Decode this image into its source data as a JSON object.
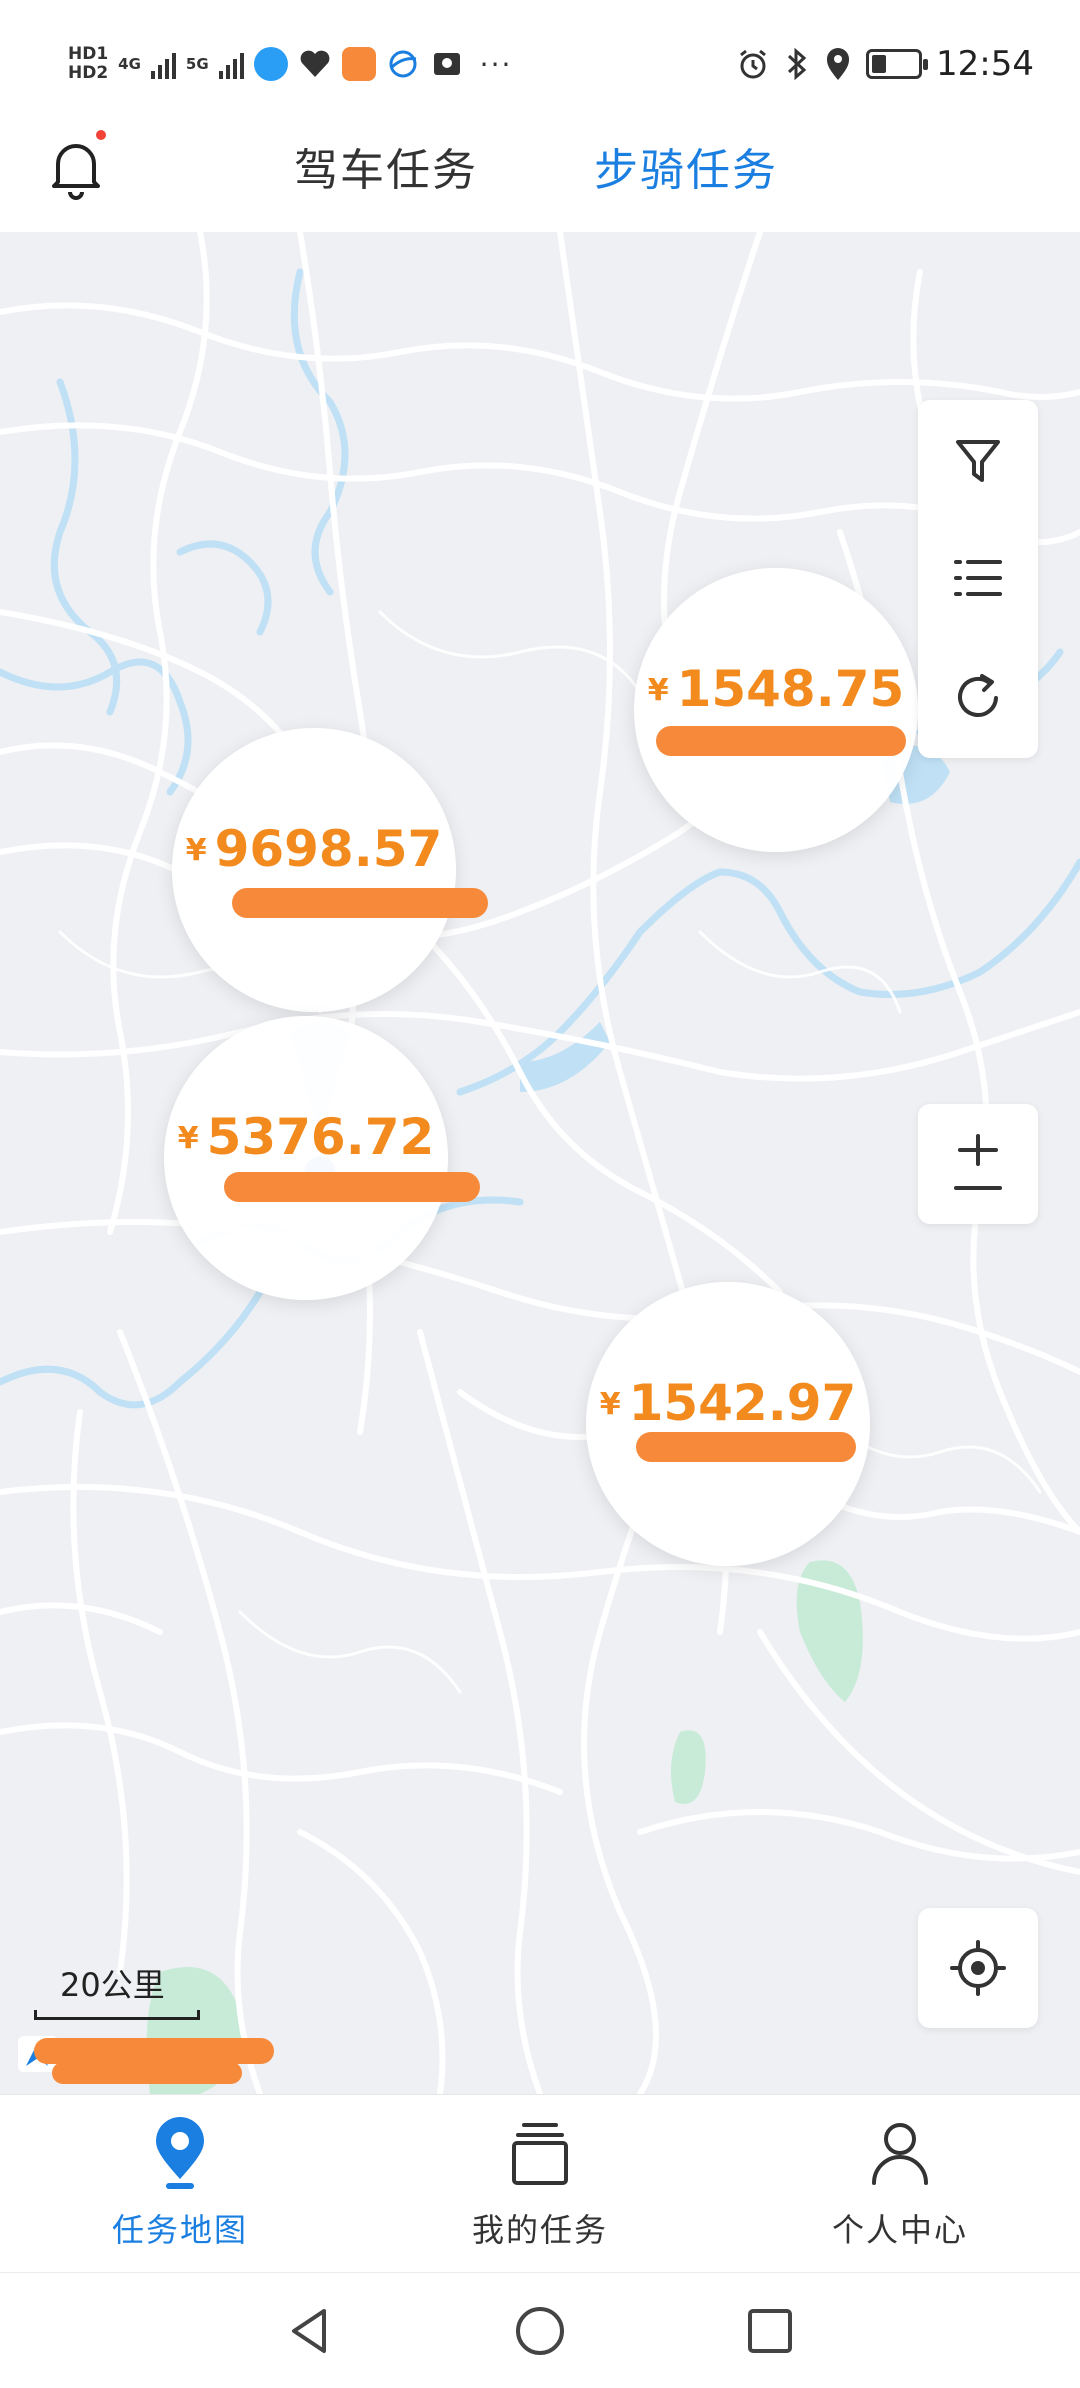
{
  "status_bar": {
    "hd1": "HD1",
    "hd2": "HD2",
    "net1": "4G",
    "net2": "5G",
    "more": "···",
    "time": "12:54",
    "icons": [
      "alarm-icon",
      "bluetooth-icon",
      "location-icon",
      "battery-icon"
    ]
  },
  "header": {
    "tabs": [
      {
        "label": "驾车任务",
        "active": false
      },
      {
        "label": "步骑任务",
        "active": true
      }
    ],
    "accent_color": "#1a7fe0"
  },
  "map": {
    "tasks": [
      {
        "currency": "¥",
        "amount": "1548.75"
      },
      {
        "currency": "¥",
        "amount": "9698.57"
      },
      {
        "currency": "¥",
        "amount": "5376.72"
      },
      {
        "currency": "¥",
        "amount": "1542.97"
      }
    ],
    "price_color": "#f28a1e",
    "scale_label": "20公里",
    "controls": [
      "filter-icon",
      "list-icon",
      "refresh-icon",
      "zoom-icon",
      "locate-icon"
    ]
  },
  "bottom_nav": {
    "items": [
      {
        "label": "任务地图",
        "icon": "map-pin-icon",
        "active": true
      },
      {
        "label": "我的任务",
        "icon": "stack-icon",
        "active": false
      },
      {
        "label": "个人中心",
        "icon": "person-icon",
        "active": false
      }
    ]
  },
  "system_nav": [
    "back-icon",
    "home-icon",
    "recents-icon"
  ]
}
